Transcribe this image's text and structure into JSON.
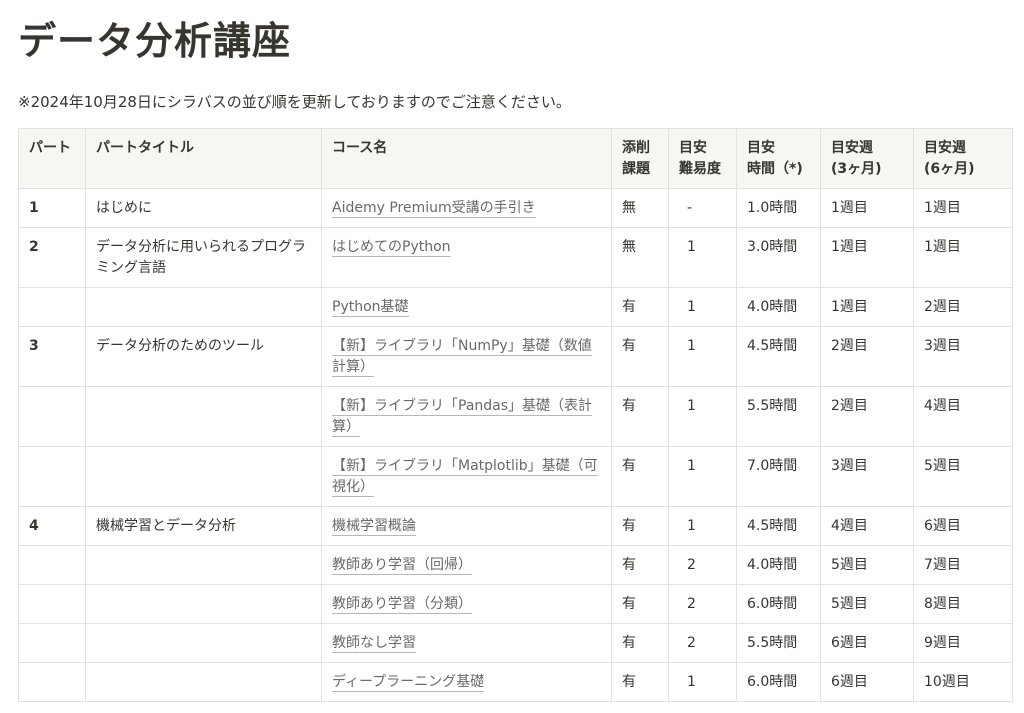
{
  "page": {
    "title": "データ分析講座",
    "notice": "※2024年10月28日にシラバスの並び順を更新しておりますのでご注意ください。"
  },
  "table": {
    "headers": [
      [
        "パート"
      ],
      [
        "パートタイトル"
      ],
      [
        "コース名"
      ],
      [
        "添削",
        "課題"
      ],
      [
        "目安",
        "難易度"
      ],
      [
        "目安",
        "時間（*)"
      ],
      [
        "目安週",
        "(3ヶ月)"
      ],
      [
        "目安週",
        "(6ヶ月)"
      ]
    ],
    "rows": [
      {
        "part": "1",
        "part_title": "はじめに",
        "course": "Aidemy Premium受講の手引き",
        "assignment": "無",
        "difficulty": "-",
        "hours": "1.0時間",
        "week3": "1週目",
        "week6": "1週目"
      },
      {
        "part": "2",
        "part_title": "データ分析に用いられるプログラミング言語",
        "course": "はじめてのPython",
        "assignment": "無",
        "difficulty": "1",
        "hours": "3.0時間",
        "week3": "1週目",
        "week6": "1週目"
      },
      {
        "part": "",
        "part_title": "",
        "course": "Python基礎",
        "assignment": "有",
        "difficulty": "1",
        "hours": "4.0時間",
        "week3": "1週目",
        "week6": "2週目"
      },
      {
        "part": "3",
        "part_title": "データ分析のためのツール",
        "course": "【新】ライブラリ「NumPy」基礎（数値計算）",
        "assignment": "有",
        "difficulty": "1",
        "hours": "4.5時間",
        "week3": "2週目",
        "week6": "3週目"
      },
      {
        "part": "",
        "part_title": "",
        "course": "【新】ライブラリ「Pandas」基礎（表計算）",
        "assignment": "有",
        "difficulty": "1",
        "hours": "5.5時間",
        "week3": "2週目",
        "week6": "4週目"
      },
      {
        "part": "",
        "part_title": "",
        "course": "【新】ライブラリ「Matplotlib」基礎（可視化）",
        "assignment": "有",
        "difficulty": "1",
        "hours": "7.0時間",
        "week3": "3週目",
        "week6": "5週目"
      },
      {
        "part": "4",
        "part_title": "機械学習とデータ分析",
        "course": "機械学習概論",
        "assignment": "有",
        "difficulty": "1",
        "hours": "4.5時間",
        "week3": "4週目",
        "week6": "6週目"
      },
      {
        "part": "",
        "part_title": "",
        "course": "教師あり学習（回帰）",
        "assignment": "有",
        "difficulty": "2",
        "hours": "4.0時間",
        "week3": "5週目",
        "week6": "7週目"
      },
      {
        "part": "",
        "part_title": "",
        "course": "教師あり学習（分類）",
        "assignment": "有",
        "difficulty": "2",
        "hours": "6.0時間",
        "week3": "5週目",
        "week6": "8週目"
      },
      {
        "part": "",
        "part_title": "",
        "course": "教師なし学習",
        "assignment": "有",
        "difficulty": "2",
        "hours": "5.5時間",
        "week3": "6週目",
        "week6": "9週目"
      },
      {
        "part": "",
        "part_title": "",
        "course": "ディープラーニング基礎",
        "assignment": "有",
        "difficulty": "1",
        "hours": "6.0時間",
        "week3": "6週目",
        "week6": "10週目"
      }
    ]
  }
}
